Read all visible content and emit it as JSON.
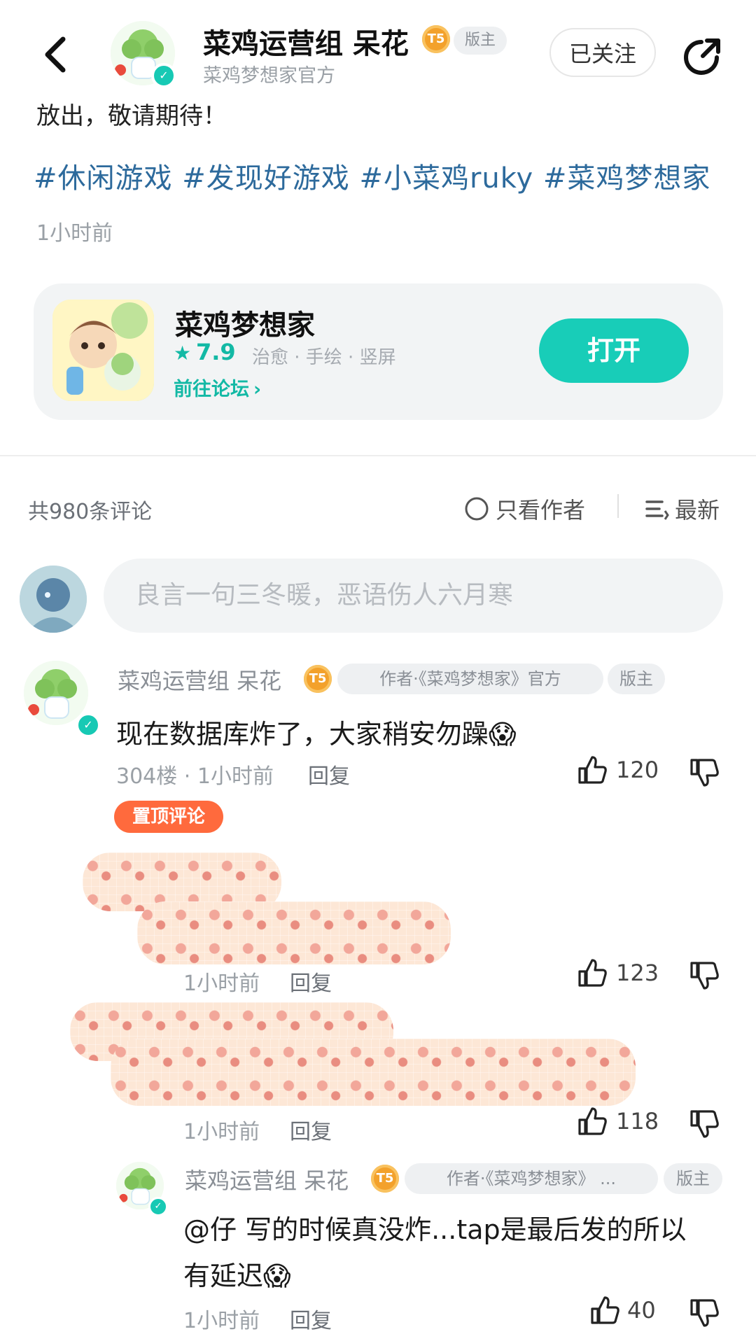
{
  "header": {
    "username": "菜鸡运营组 呆花",
    "level_badge": "T5",
    "role_badge": "版主",
    "subtitle": "菜鸡梦想家官方",
    "follow_label": "已关注"
  },
  "post": {
    "text_tail": "放出，敬请期待！",
    "tags": "#休闲游戏 #发现好游戏 #小菜鸡ruky #菜鸡梦想家",
    "time": "1小时前"
  },
  "game_card": {
    "name": "菜鸡梦想家",
    "rating_star": "★",
    "rating": "7.9",
    "genres": "治愈 · 手绘 · 竖屏",
    "forum_link": "前往论坛",
    "open_label": "打开"
  },
  "comments_header": {
    "count": "共980条评论",
    "author_only": "只看作者",
    "sort": "最新"
  },
  "input": {
    "placeholder": "良言一句三冬暖，恶语伤人六月寒"
  },
  "comments": [
    {
      "username": "菜鸡运营组 呆花",
      "level": "T5",
      "author_tag": "作者·《菜鸡梦想家》官方",
      "role": "版主",
      "text": "现在数据库炸了，大家稍安勿躁😱",
      "meta": "304楼 · 1小时前",
      "reply": "回复",
      "likes": "120",
      "pinned": "置顶评论"
    }
  ],
  "replies": [
    {
      "meta": "1小时前",
      "reply": "回复",
      "likes": "123"
    },
    {
      "meta": "1小时前",
      "reply": "回复",
      "likes": "118"
    },
    {
      "username": "菜鸡运营组 呆花",
      "level": "T5",
      "author_tag": "作者·《菜鸡梦想家》 ...",
      "role": "版主",
      "text_line1": "@仔  写的时候真没炸...tap是最后发的所以",
      "text_line2": "有延迟😱",
      "meta": "1小时前",
      "reply": "回复",
      "likes": "40"
    }
  ],
  "colors": {
    "accent": "#18cdb8",
    "tag_blue": "#2d6a9c",
    "pinned": "#ff6a3d",
    "badge": "#f3a12b"
  },
  "icons": [
    "back-arrow-icon",
    "share-icon",
    "verified-icon",
    "star-icon",
    "chevron-right-icon",
    "circle-radio-icon",
    "sort-icon",
    "thumbs-up-icon",
    "thumbs-down-icon"
  ]
}
